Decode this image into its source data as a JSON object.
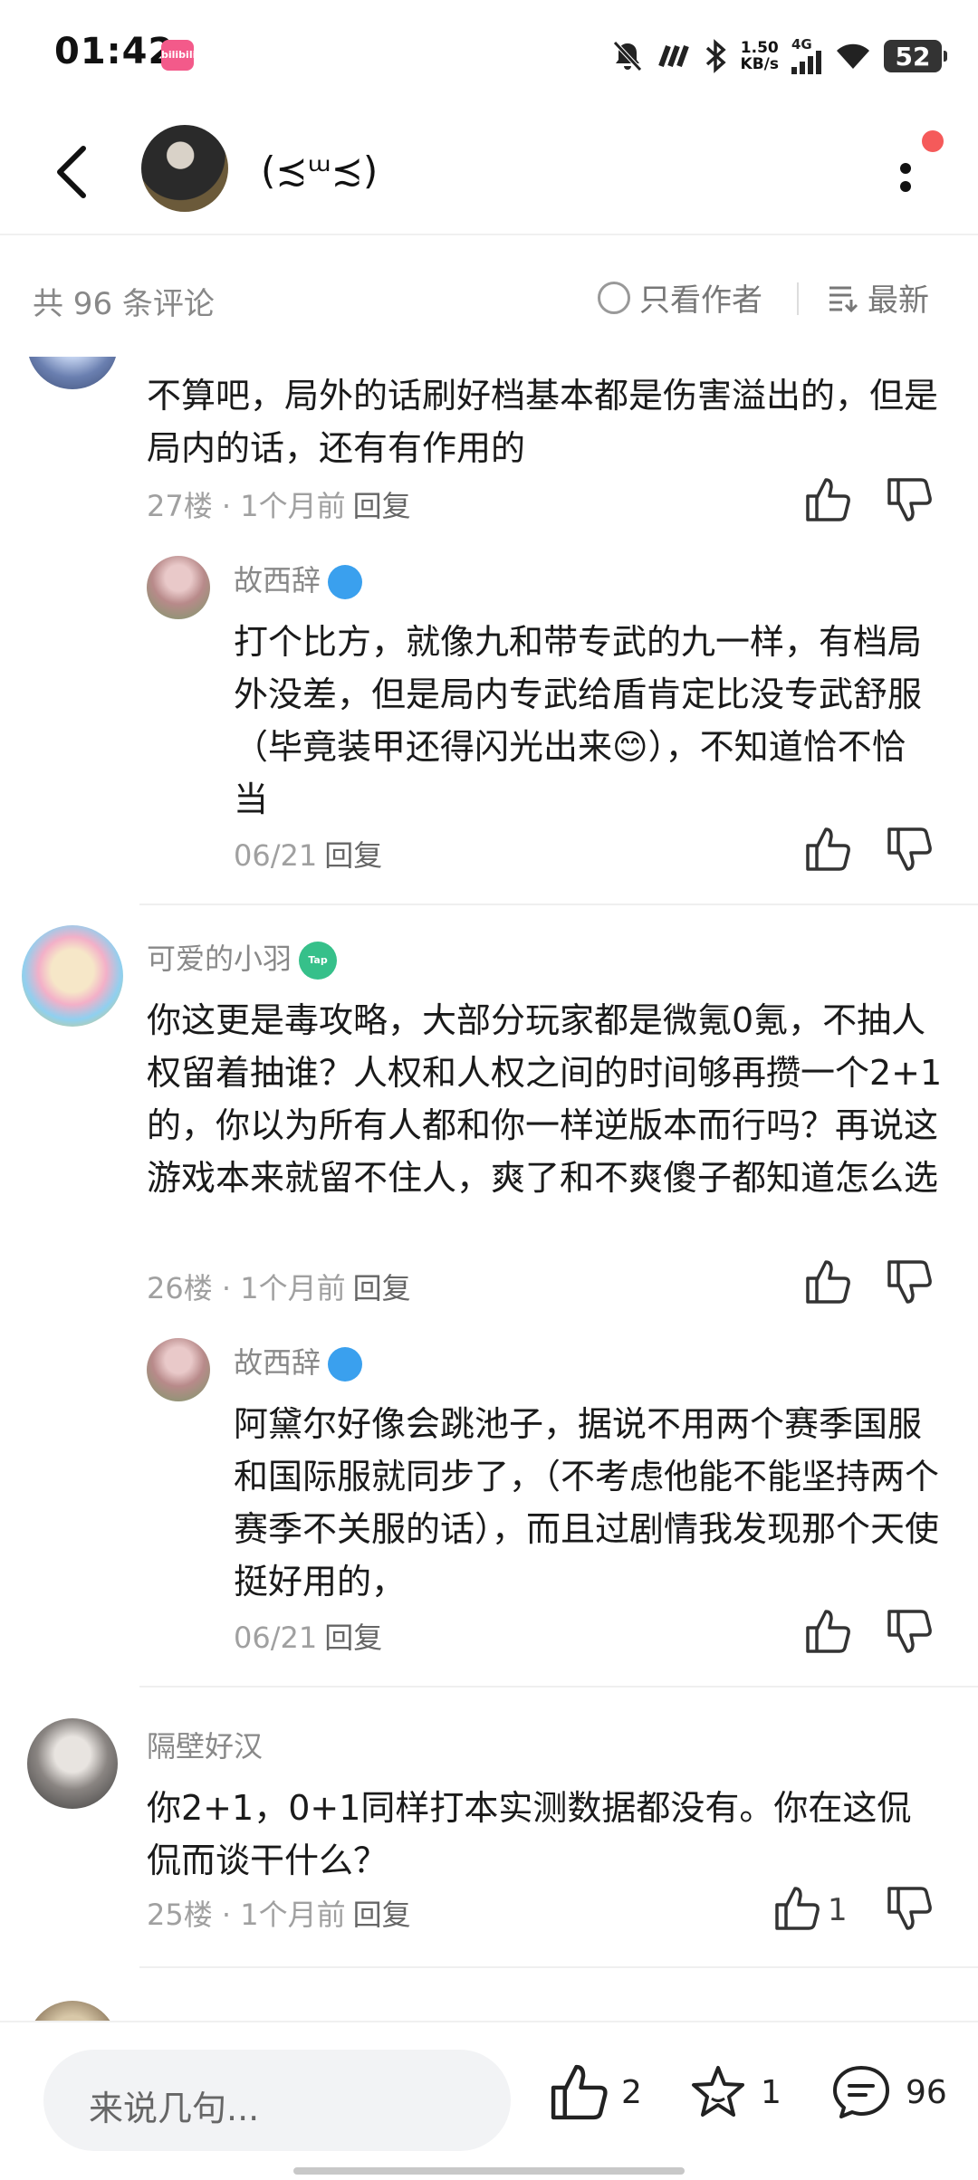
{
  "status_bar": {
    "time": "01:42",
    "app_badge": "bilibili",
    "speed_value": "1.50",
    "speed_unit": "KB/s",
    "network": "4G",
    "battery": "52"
  },
  "header": {
    "title": "(≾ᵚ≾)"
  },
  "comment_bar": {
    "count_text": "共 96 条评论",
    "author_only_label": "只看作者",
    "sort_label": "最新"
  },
  "comments": [
    {
      "text": "不算吧，局外的话刷好档基本都是伤害溢出的，但是局内的话，还有有作用的",
      "floor": "27楼",
      "time": "1个月前",
      "reply_label": "回复",
      "reply": {
        "name": "故西辞",
        "text": "打个比方，就像九和带专武的九一样，有档局外没差，但是局内专武给盾肯定比没专武舒服（毕竟装甲还得闪光出来😊），不知道恰不恰当",
        "time": "06/21",
        "reply_label": "回复"
      }
    },
    {
      "name": "可爱的小羽",
      "text": "你这更是毒攻略，大部分玩家都是微氪0氪，不抽人权留着抽谁？人权和人权之间的时间够再攒一个2+1的，你以为所有人都和你一样逆版本而行吗？再说这游戏本来就留不住人，爽了和不爽傻子都知道怎么选",
      "floor": "26楼",
      "time": "1个月前",
      "reply_label": "回复",
      "reply": {
        "name": "故西辞",
        "text": "阿黛尔好像会跳池子，据说不用两个赛季国服和国际服就同步了，（不考虑他能不能坚持两个赛季不关服的话），而且过剧情我发现那个天使挺好用的，",
        "time": "06/21",
        "reply_label": "回复"
      }
    },
    {
      "name": "隔壁好汉",
      "text": "你2+1，0+1同样打本实测数据都没有。你在这侃侃而谈干什么？",
      "floor": "25楼",
      "time": "1个月前",
      "reply_label": "回复",
      "likes": "1"
    }
  ],
  "bottom_bar": {
    "input_placeholder": "来说几句...",
    "like_count": "2",
    "star_count": "1",
    "comment_count": "96"
  },
  "colors": {
    "accent_red": "#f55a5a",
    "meta_gray": "#a0a0a0",
    "name_gray": "#888888",
    "badge_blue": "#3aa0ee",
    "badge_green": "#36c08a"
  },
  "icons": [
    "back-icon",
    "more-icon",
    "circle-icon",
    "sort-icon",
    "thumb-up-icon",
    "thumb-down-icon",
    "star-icon",
    "comment-icon",
    "notification-off-icon",
    "bluetooth-icon",
    "signal-icon",
    "wifi-icon",
    "battery-icon"
  ]
}
